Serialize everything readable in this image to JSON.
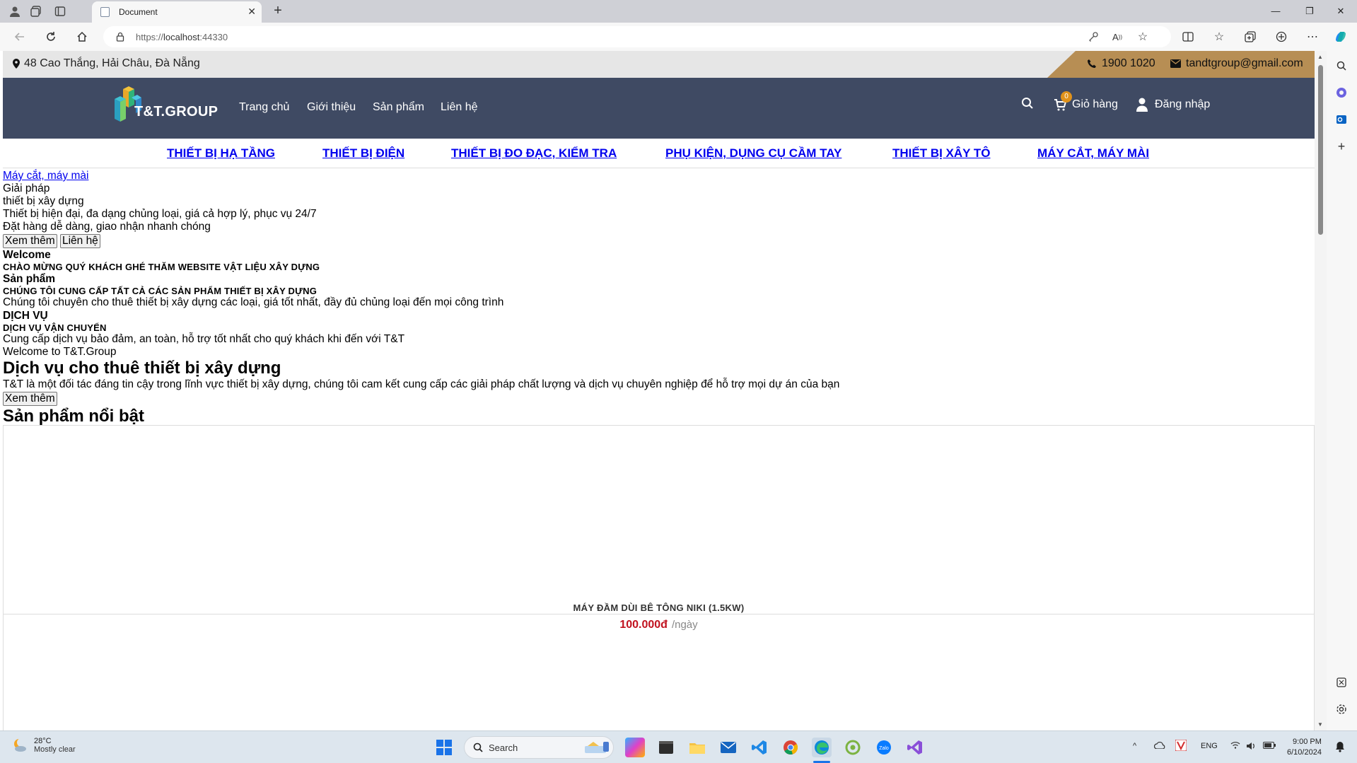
{
  "browser": {
    "tab_title": "Document",
    "url_prefix": "https://",
    "url_host": "localhost",
    "url_port": ":44330"
  },
  "topbar": {
    "address": "48 Cao Thắng, Hải Châu, Đà Nẵng",
    "phone": "1900 1020",
    "email": "tandtgroup@gmail.com"
  },
  "header": {
    "logo_text": "T&T.GROUP",
    "nav": [
      "Trang chủ",
      "Giới thiệu",
      "Sản phẩm",
      "Liên hệ"
    ],
    "cart_count": "0",
    "cart_label": "Giỏ hàng",
    "login_label": "Đăng nhập"
  },
  "categories": [
    "THIẾT BỊ HẠ TẦNG",
    "THIẾT BỊ ĐIỆN",
    "THIẾT BỊ ĐO ĐẠC, KIỂM TRA",
    "PHỤ KIỆN, DỤNG CỤ CẦM TAY",
    "THIẾT BỊ XÂY TÔ",
    "MÁY CẮT, MÁY MÀI"
  ],
  "hero": {
    "link": "Máy cắt, máy mài",
    "line1": "Giải pháp",
    "line2": "thiết bị xây dựng",
    "line3": "Thiết bị hiện đại, đa dạng chủng loại, giá cả hợp lý, phục vụ 24/7",
    "line4": "Đặt hàng dễ dàng, giao nhận nhanh chóng",
    "btn_more": "Xem thêm",
    "btn_contact": "Liên hệ"
  },
  "features": {
    "welcome_title": "Welcome",
    "welcome_sub": "CHÀO MỪNG QUÝ KHÁCH GHÉ THĂM WEBSITE VẬT LIỆU XÂY DỰNG",
    "products_title": "Sản phẩm",
    "products_sub": "CHÚNG TÔI CUNG CẤP TẤT CẢ CÁC SẢN PHẨM THIẾT BỊ XÂY DỰNG",
    "products_desc": "Chúng tôi chuyên cho thuê thiết bị xây dựng các loại, giá tốt nhất, đầy đủ chủng loại đến mọi công trình",
    "service_title": "DỊCH VỤ",
    "service_sub": "DỊCH VỤ VẬN CHUYỂN",
    "service_desc": "Cung cấp dịch vụ bảo đảm, an toàn, hỗ trợ tốt nhất cho quý khách khi đến với T&T"
  },
  "about": {
    "kicker": "Welcome to T&T.Group",
    "title": "Dịch vụ cho thuê thiết bị xây dựng",
    "desc": "T&T là một đối tác đáng tin cậy trong lĩnh vực thiết bị xây dựng, chúng tôi cam kết cung cấp các giải pháp chất lượng và dịch vụ chuyên nghiệp để hỗ trợ mọi dự án của bạn",
    "btn": "Xem thêm"
  },
  "featured": {
    "title": "Sản phẩm nổi bật",
    "product_name": "MÁY ĐẦM DÙI BÊ TÔNG NIKI (1.5KW)",
    "price": "100.000đ",
    "unit": "/ngày"
  },
  "taskbar": {
    "temp": "28°C",
    "weather": "Mostly clear",
    "search": "Search",
    "lang": "ENG",
    "time": "9:00 PM",
    "date": "6/10/2024"
  },
  "colors": {
    "header_bg": "#3f4a63",
    "gold": "#b78e54",
    "price_red": "#c1121f",
    "link_blue": "#0000ee"
  }
}
